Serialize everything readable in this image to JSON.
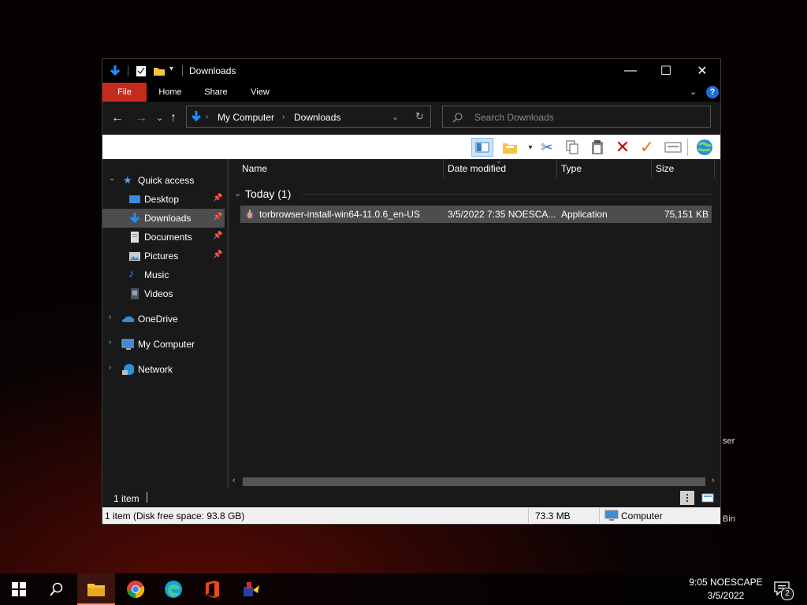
{
  "desktop": {
    "label_ser": "ser",
    "label_bin": "Bin"
  },
  "window": {
    "title": "Downloads",
    "controls": {
      "minimize": "—",
      "maximize": "☐",
      "close": "✕"
    }
  },
  "ribbon": {
    "tabs": [
      "File",
      "Home",
      "Share",
      "View"
    ]
  },
  "address": {
    "crumbs": [
      "My Computer",
      "Downloads"
    ]
  },
  "search": {
    "placeholder": "Search Downloads"
  },
  "nav": {
    "quick_access": "Quick access",
    "items": [
      {
        "label": "Desktop",
        "pinned": true
      },
      {
        "label": "Downloads",
        "pinned": true,
        "selected": true
      },
      {
        "label": "Documents",
        "pinned": true
      },
      {
        "label": "Pictures",
        "pinned": true
      },
      {
        "label": "Music",
        "pinned": false
      },
      {
        "label": "Videos",
        "pinned": false
      }
    ],
    "onedrive": "OneDrive",
    "my_computer": "My Computer",
    "network": "Network"
  },
  "columns": {
    "name": "Name",
    "date": "Date modified",
    "type": "Type",
    "size": "Size"
  },
  "group": {
    "label": "Today (1)"
  },
  "files": [
    {
      "name": "torbrowser-install-win64-11.0.6_en-US",
      "date": "3/5/2022 7:35 NOESCA...",
      "type": "Application",
      "size": "75,151 KB"
    }
  ],
  "status": {
    "item_count": "1 item",
    "detail": "1 item (Disk free space: 93.8 GB)",
    "size": "73.3 MB",
    "location": "Computer"
  },
  "taskbar": {
    "time": "9:05 NOESCAPE",
    "date": "3/5/2022",
    "notifications": "2"
  },
  "colors": {
    "accent": "#c42b1c",
    "folder": "#f5c343",
    "download_arrow": "#1e90ff"
  }
}
